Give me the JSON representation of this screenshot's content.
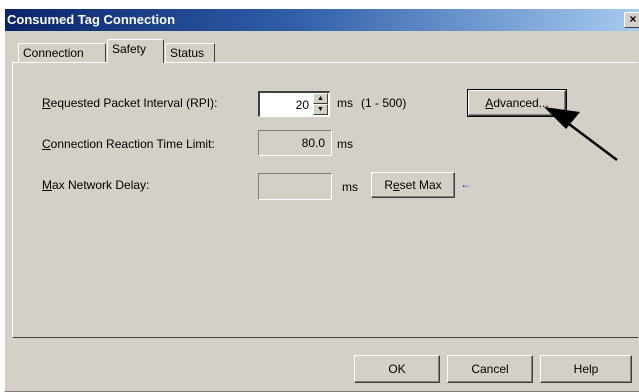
{
  "window": {
    "title": "Consumed Tag Connection",
    "close_glyph": "×"
  },
  "tabs": [
    {
      "label": "Connection"
    },
    {
      "label": "Safety"
    },
    {
      "label": "Status"
    }
  ],
  "safety": {
    "rpi": {
      "label_first": "R",
      "label_rest": "equested Packet Interval (RPI):",
      "value": "20",
      "unit": "ms",
      "range": "(1 - 500)"
    },
    "reaction": {
      "label_first": "C",
      "label_rest": "onnection Reaction Time Limit:",
      "value": "80.0",
      "unit": "ms"
    },
    "max_delay": {
      "label_first": "M",
      "label_rest": "ax Network Delay:",
      "value": "",
      "unit": "ms"
    },
    "advanced_button": {
      "first": "A",
      "rest": "dvanced..."
    },
    "reset_button": {
      "pre": "R",
      "u": "e",
      "post": "set Max"
    },
    "reset_arrow_glyph": "←"
  },
  "buttons": {
    "ok": "OK",
    "cancel": "Cancel",
    "help": "Help"
  },
  "annotation": {
    "arrow_color": "#000000"
  }
}
